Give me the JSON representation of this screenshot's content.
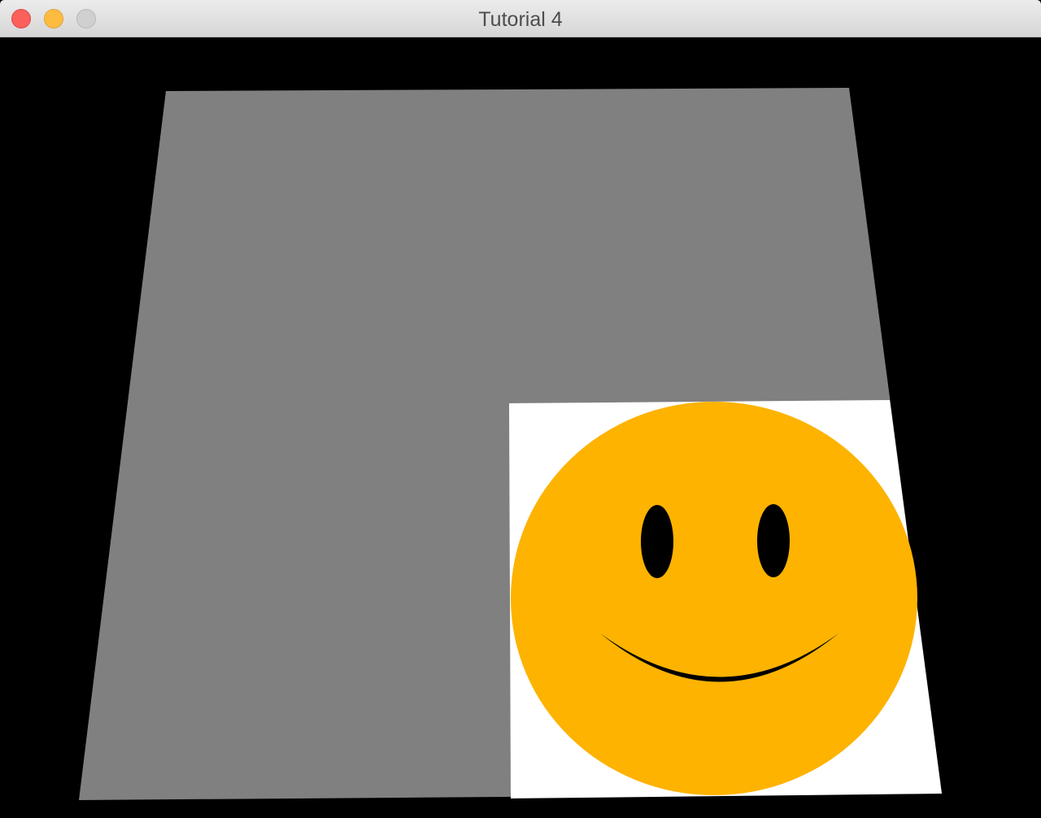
{
  "window": {
    "title": "Tutorial 4",
    "buttons": {
      "close": "close-button",
      "minimize": "minimize-button",
      "zoom": "zoom-button"
    }
  },
  "scene": {
    "background_color": "#000000",
    "quad_color": "#808080",
    "texture_background": "#ffffff",
    "smiley": {
      "face_color": "#fdb300",
      "feature_color": "#000000",
      "icon": "smiley-face-icon"
    }
  }
}
